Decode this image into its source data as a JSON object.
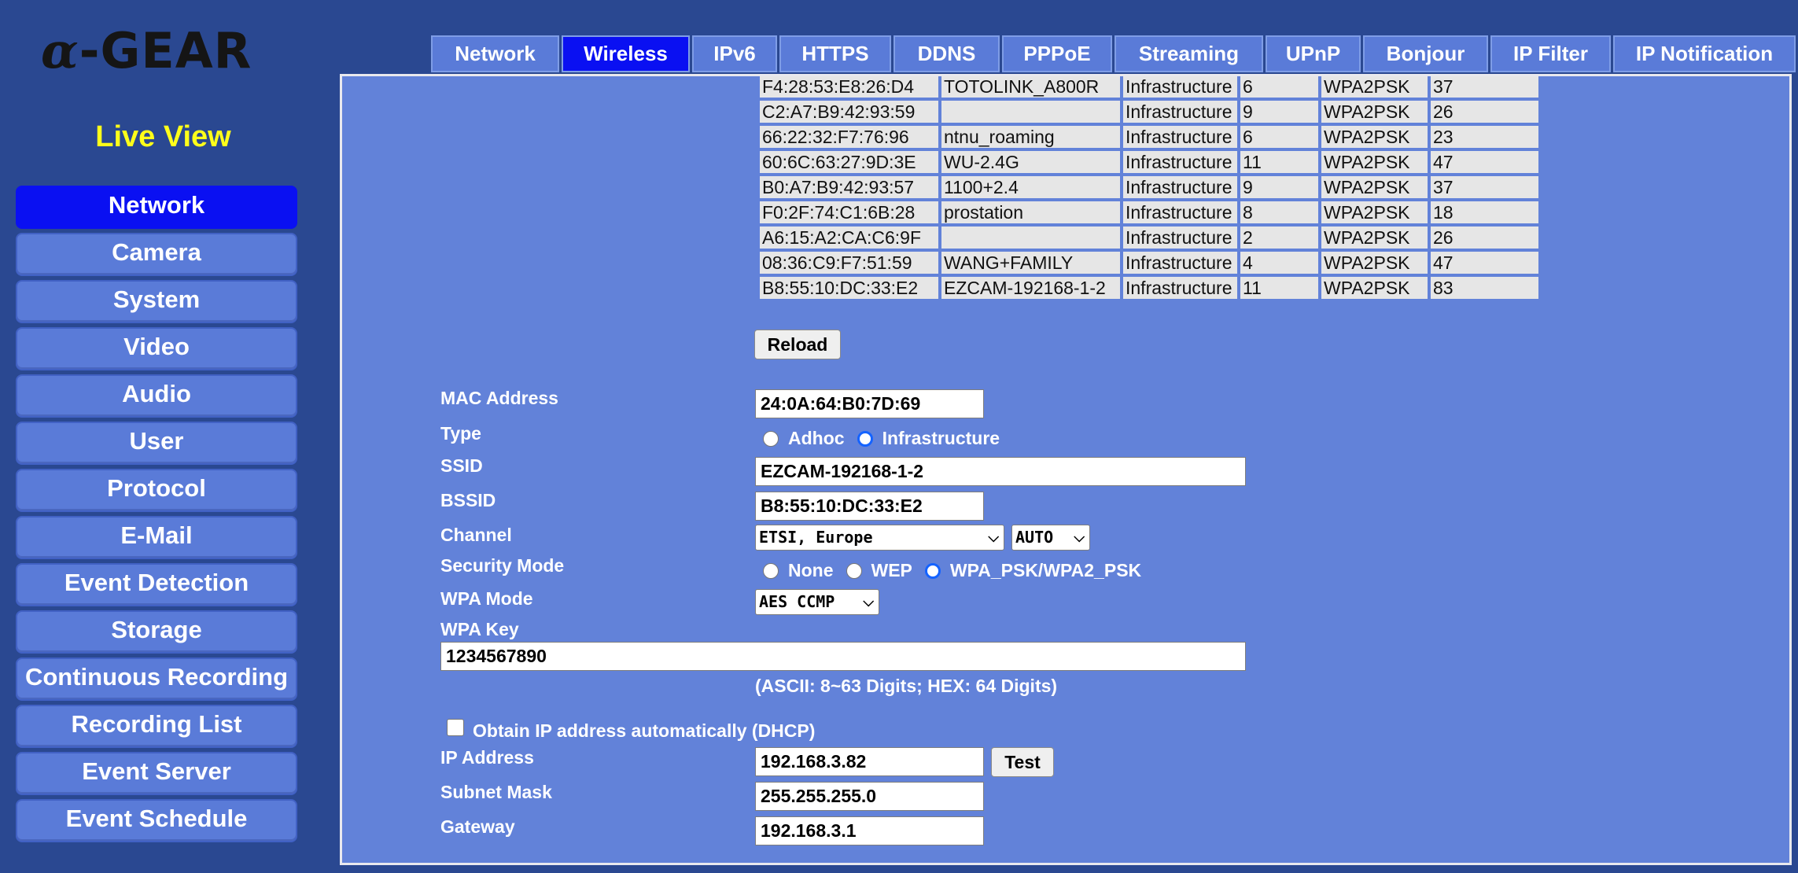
{
  "logo": {
    "alpha": "α",
    "text": "-GEAR"
  },
  "live_view": "Live View",
  "sidebar": {
    "items": [
      {
        "label": "Network",
        "active": true
      },
      {
        "label": "Camera"
      },
      {
        "label": "System"
      },
      {
        "label": "Video"
      },
      {
        "label": "Audio"
      },
      {
        "label": "User"
      },
      {
        "label": "Protocol"
      },
      {
        "label": "E-Mail"
      },
      {
        "label": "Event Detection"
      },
      {
        "label": "Storage"
      },
      {
        "label": "Continuous Recording"
      },
      {
        "label": "Recording List"
      },
      {
        "label": "Event Server"
      },
      {
        "label": "Event Schedule"
      }
    ]
  },
  "tabs": [
    {
      "label": "Network"
    },
    {
      "label": "Wireless",
      "active": true
    },
    {
      "label": "IPv6"
    },
    {
      "label": "HTTPS"
    },
    {
      "label": "DDNS"
    },
    {
      "label": "PPPoE"
    },
    {
      "label": "Streaming"
    },
    {
      "label": "UPnP"
    },
    {
      "label": "Bonjour"
    },
    {
      "label": "IP Filter"
    },
    {
      "label": "IP Notification"
    }
  ],
  "survey": {
    "rows": [
      [
        "F4:28:53:E8:26:D4",
        "TOTOLINK_A800R",
        "Infrastructure",
        "6",
        "WPA2PSK",
        "37"
      ],
      [
        "C2:A7:B9:42:93:59",
        "",
        "Infrastructure",
        "9",
        "WPA2PSK",
        "26"
      ],
      [
        "66:22:32:F7:76:96",
        "ntnu_roaming",
        "Infrastructure",
        "6",
        "WPA2PSK",
        "23"
      ],
      [
        "60:6C:63:27:9D:3E",
        "WU-2.4G",
        "Infrastructure",
        "11",
        "WPA2PSK",
        "47"
      ],
      [
        "B0:A7:B9:42:93:57",
        "1100+2.4",
        "Infrastructure",
        "9",
        "WPA2PSK",
        "37"
      ],
      [
        "F0:2F:74:C1:6B:28",
        "prostation",
        "Infrastructure",
        "8",
        "WPA2PSK",
        "18"
      ],
      [
        "A6:15:A2:CA:C6:9F",
        "",
        "Infrastructure",
        "2",
        "WPA2PSK",
        "26"
      ],
      [
        "08:36:C9:F7:51:59",
        "WANG+FAMILY",
        "Infrastructure",
        "4",
        "WPA2PSK",
        "47"
      ],
      [
        "B8:55:10:DC:33:E2",
        "EZCAM-192168-1-2",
        "Infrastructure",
        "11",
        "WPA2PSK",
        "83"
      ]
    ],
    "reload_label": "Reload"
  },
  "form": {
    "mac_label": "MAC Address",
    "mac_value": "24:0A:64:B0:7D:69",
    "type_label": "Type",
    "type_options": [
      "Adhoc",
      "Infrastructure"
    ],
    "type_selected": "Infrastructure",
    "ssid_label": "SSID",
    "ssid_value": "EZCAM-192168-1-2",
    "bssid_label": "BSSID",
    "bssid_value": "B8:55:10:DC:33:E2",
    "channel_label": "Channel",
    "channel_region": "ETSI, Europe",
    "channel_value": "AUTO",
    "security_label": "Security Mode",
    "security_options": [
      "None",
      "WEP",
      "WPA_PSK/WPA2_PSK"
    ],
    "security_selected": "WPA_PSK/WPA2_PSK",
    "wpa_mode_label": "WPA Mode",
    "wpa_mode_value": "AES CCMP",
    "wpa_key_label": "WPA Key",
    "wpa_key_value": "1234567890",
    "wpa_key_hint": "(ASCII: 8~63 Digits; HEX: 64 Digits)",
    "dhcp_label": "Obtain IP address automatically (DHCP)",
    "dhcp_checked": false,
    "ip_label": "IP Address",
    "ip_value": "192.168.3.82",
    "test_label": "Test",
    "subnet_label": "Subnet Mask",
    "subnet_value": "255.255.255.0",
    "gateway_label": "Gateway",
    "gateway_value": "192.168.3.1"
  },
  "colors": {
    "background": "#2a4891",
    "panel": "#6282d9",
    "active": "#0a10f2",
    "button": "#5a7bd8",
    "live_view": "#ffff1a"
  }
}
